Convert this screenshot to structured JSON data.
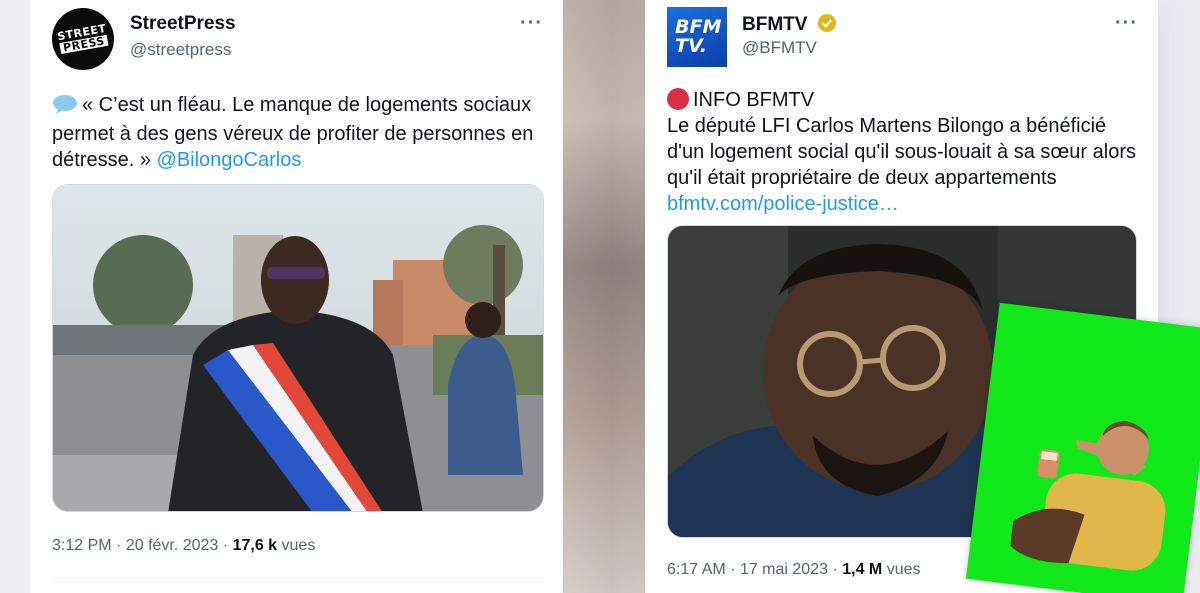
{
  "left_tweet": {
    "name": "StreetPress",
    "handle": "@streetpress",
    "avatar_lines": [
      "STREET",
      "PRESS"
    ],
    "text_prefix_icon": "speech-bubble-icon",
    "text": "« C’est un fléau. Le manque de logements sociaux permet à des gens véreux de profiter de personnes en détresse. »",
    "mention": "@BilongoCarlos",
    "time": "3:12 PM",
    "date": "20 févr. 2023",
    "views_count": "17,6 k",
    "views_label": "vues"
  },
  "right_tweet": {
    "name": "BFMTV",
    "handle": "@BFMTV",
    "avatar_lines": [
      "BFM",
      "TV."
    ],
    "verified": true,
    "alert_icon": "red-circle-icon",
    "headline": "INFO BFMTV",
    "text": "Le député LFI Carlos Martens Bilongo a bénéficié d'un logement social qu'il sous-louait à sa sœur alors qu'il était propriétaire de deux appartements",
    "link": "bfmtv.com/police-justice…",
    "time": "6:17 AM",
    "date": "17 mai 2023",
    "views_count": "1,4 M",
    "views_label": "vues"
  },
  "separator": "·",
  "more_label": "···",
  "colors": {
    "link": "#1d9bf0",
    "text": "#0f1419",
    "muted": "#536471",
    "sticker_green": "#10e81a",
    "verified_gold": "#e2b719"
  }
}
